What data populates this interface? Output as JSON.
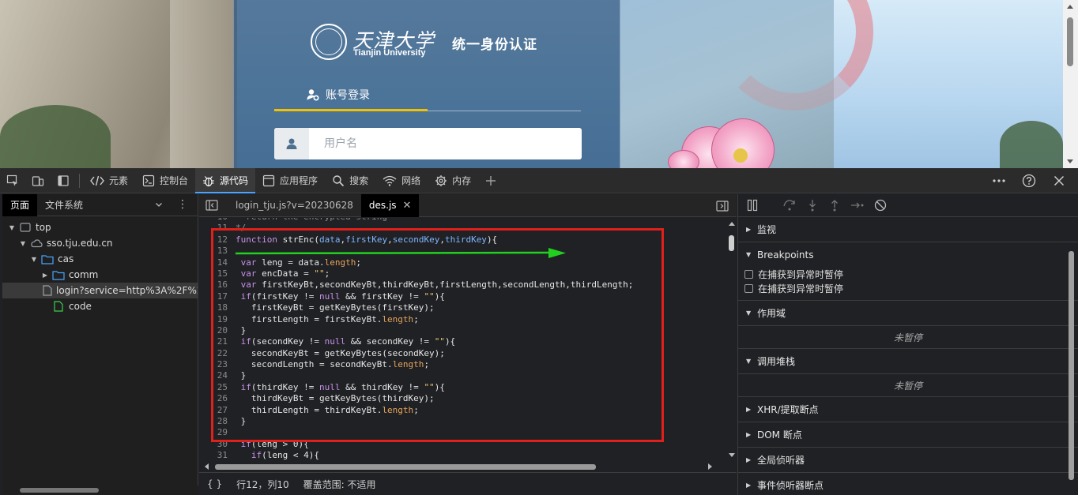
{
  "webpage": {
    "university_cn": "天津大学",
    "university_en": "Tianjin University",
    "system_title": "统一身份认证",
    "login_tab": "账号登录",
    "username_placeholder": "用户名"
  },
  "devtools": {
    "tabs": [
      {
        "label": "元素",
        "icon": "code-brackets-icon"
      },
      {
        "label": "控制台",
        "icon": "console-icon"
      },
      {
        "label": "源代码",
        "icon": "bug-icon",
        "active": true
      },
      {
        "label": "应用程序",
        "icon": "application-icon"
      },
      {
        "label": "搜索",
        "icon": "search-icon"
      },
      {
        "label": "网络",
        "icon": "wifi-icon"
      },
      {
        "label": "内存",
        "icon": "memory-chip-icon"
      }
    ],
    "navigator": {
      "tabs": [
        "页面",
        "文件系统"
      ],
      "tree": [
        {
          "label": "top",
          "depth": 0,
          "icon": "frame-icon",
          "expanded": true
        },
        {
          "label": "sso.tju.edu.cn",
          "depth": 1,
          "icon": "cloud-icon",
          "expanded": true
        },
        {
          "label": "cas",
          "depth": 2,
          "icon": "folder-icon",
          "expanded": true
        },
        {
          "label": "comm",
          "depth": 3,
          "icon": "folder-icon",
          "expanded": false
        },
        {
          "label": "login?service=http%3A%2F%2F",
          "depth": 3,
          "icon": "file-icon",
          "selected": true
        },
        {
          "label": "code",
          "depth": 3,
          "icon": "green-file-icon"
        }
      ]
    },
    "editor": {
      "tabs": [
        {
          "label": "login_tju.js?v=20230628",
          "active": false
        },
        {
          "label": "des.js",
          "active": true
        }
      ],
      "status": {
        "braces": "{ }",
        "position": "行12，列10",
        "coverage": "覆盖范围: 不适用"
      }
    },
    "debugger": {
      "sections": {
        "watch": "监视",
        "breakpoints": "Breakpoints",
        "pause_on_exception_1": "在捕获到异常时暂停",
        "pause_on_exception_2": "在捕获到异常时暂停",
        "scope": "作用域",
        "scope_empty": "未暂停",
        "callstack": "调用堆栈",
        "callstack_empty": "未暂停",
        "xhr": "XHR/提取断点",
        "dom": "DOM 断点",
        "global": "全局侦听器",
        "event": "事件侦听器断点"
      }
    }
  }
}
